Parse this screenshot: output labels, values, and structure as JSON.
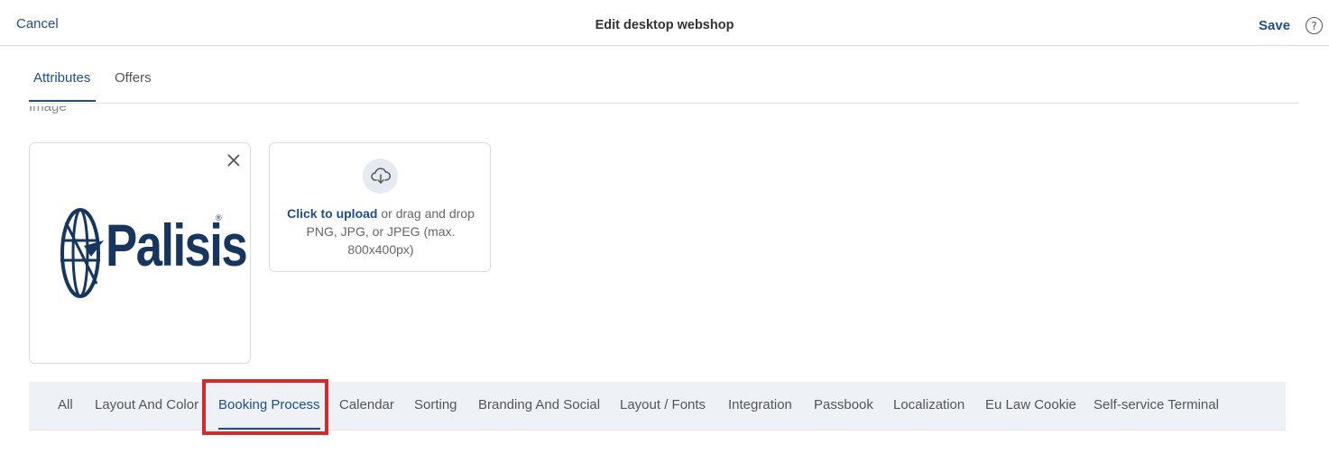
{
  "header": {
    "cancel_label": "Cancel",
    "title": "Edit desktop webshop",
    "save_label": "Save",
    "help_glyph": "?"
  },
  "tabs": [
    {
      "label": "Attributes",
      "active": true
    },
    {
      "label": "Offers",
      "active": false
    }
  ],
  "partial_label": "Image",
  "image_card": {
    "logo_text": "Palisis",
    "logo_mark": "®",
    "remove_icon": "close-icon"
  },
  "upload": {
    "icon": "cloud-download-icon",
    "link_text": "Click to upload",
    "rest_text": " or drag and drop PNG, JPG, or JPEG (max. 800x400px)"
  },
  "filters": [
    {
      "label": "All"
    },
    {
      "label": "Layout And Color"
    },
    {
      "label": "Booking Process",
      "active": true
    },
    {
      "label": "Calendar"
    },
    {
      "label": "Sorting"
    },
    {
      "label": "Branding And Social"
    },
    {
      "label": "Layout / Fonts"
    },
    {
      "label": "Integration"
    },
    {
      "label": "Passbook"
    },
    {
      "label": "Localization"
    },
    {
      "label": "Eu Law Cookie"
    },
    {
      "label": "Self-service Terminal"
    }
  ],
  "colors": {
    "accent": "#1f4e86",
    "highlight": "#d42a2a",
    "filter_bg": "#eef1f5"
  }
}
